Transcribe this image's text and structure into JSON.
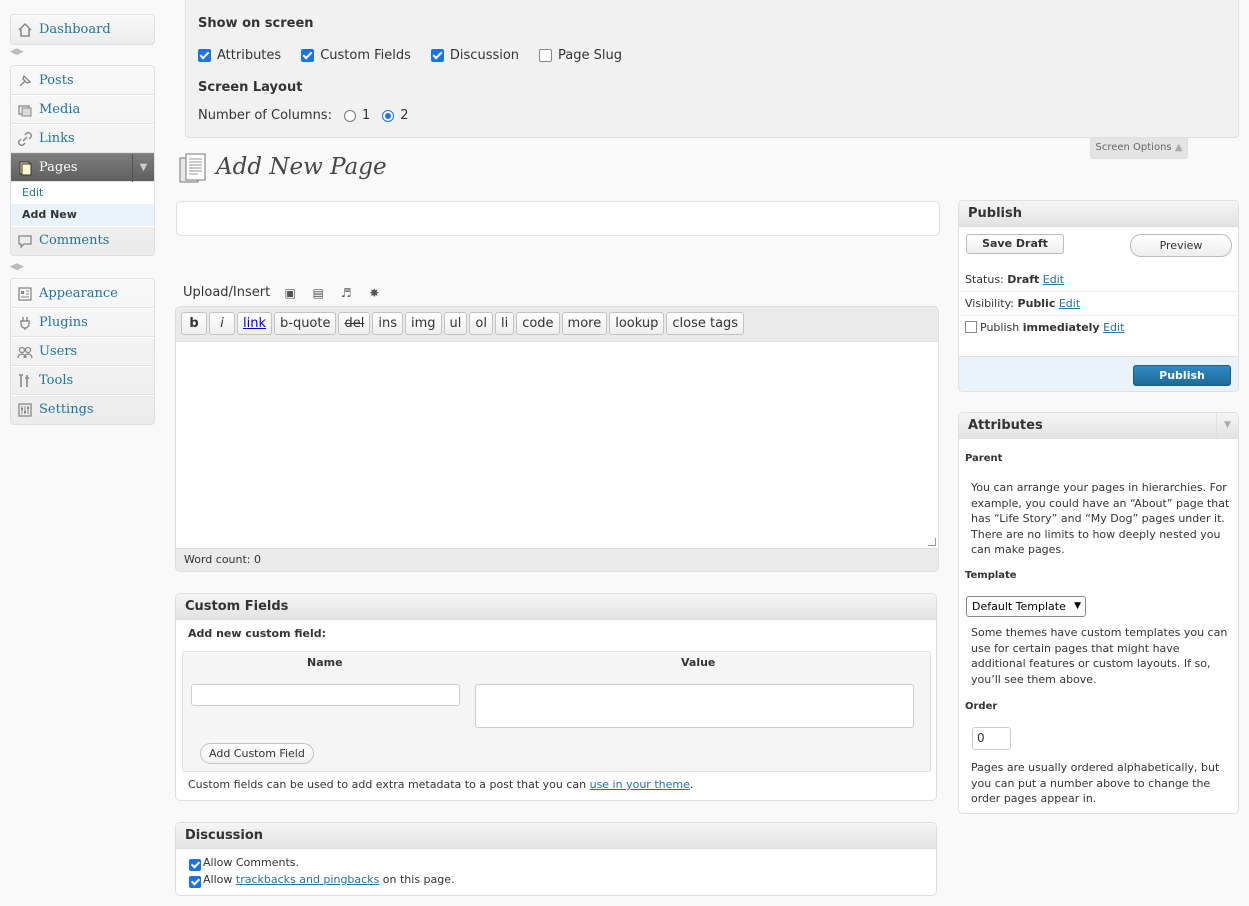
{
  "sidebar": {
    "dashboard": "Dashboard",
    "posts": "Posts",
    "media": "Media",
    "links": "Links",
    "pages": "Pages",
    "pages_sub": [
      "Edit",
      "Add New"
    ],
    "comments": "Comments",
    "appearance": "Appearance",
    "plugins": "Plugins",
    "users": "Users",
    "tools": "Tools",
    "settings": "Settings"
  },
  "screen_options": {
    "show_title": "Show on screen",
    "checkboxes": [
      {
        "label": "Attributes",
        "checked": true
      },
      {
        "label": "Custom Fields",
        "checked": true
      },
      {
        "label": "Discussion",
        "checked": true
      },
      {
        "label": "Page Slug",
        "checked": false
      }
    ],
    "layout_title": "Screen Layout",
    "columns_label": "Number of Columns:",
    "column_options": [
      "1",
      "2"
    ],
    "selected_column": "2",
    "tab_label": "Screen Options"
  },
  "page": {
    "title": "Add New Page",
    "title_value": ""
  },
  "editor": {
    "upload_label": "Upload/Insert",
    "buttons": [
      "b",
      "i",
      "link",
      "b-quote",
      "del",
      "ins",
      "img",
      "ul",
      "ol",
      "li",
      "code",
      "more",
      "lookup",
      "close tags"
    ],
    "content": "",
    "word_count": "Word count: 0"
  },
  "custom_fields": {
    "title": "Custom Fields",
    "add_new_label": "Add new custom field:",
    "col_name": "Name",
    "col_value": "Value",
    "add_button": "Add Custom Field",
    "help_prefix": "Custom fields can be used to add extra metadata to a post that you can ",
    "help_link": "use in your theme",
    "help_suffix": "."
  },
  "discussion": {
    "title": "Discussion",
    "allow_comments": "Allow Comments.",
    "allow_prefix": "Allow ",
    "allow_link": "trackbacks and pingbacks",
    "allow_suffix": " on this page."
  },
  "publish": {
    "title": "Publish",
    "save_draft": "Save Draft",
    "preview": "Preview",
    "status_label": "Status:",
    "status_value": "Draft",
    "visibility_label": "Visibility:",
    "visibility_value": "Public",
    "publish_label": "Publish",
    "publish_value": "immediately",
    "edit": "Edit",
    "publish_button": "Publish"
  },
  "attributes": {
    "title": "Attributes",
    "parent_heading": "Parent",
    "parent_help": "You can arrange your pages in hierarchies. For example, you could have an “About” page that has “Life Story” and “My Dog” pages under it. There are no limits to how deeply nested you can make pages.",
    "template_heading": "Template",
    "template_value": "Default Template",
    "template_help": "Some themes have custom templates you can use for certain pages that might have additional features or custom layouts. If so, you’ll see them above.",
    "order_heading": "Order",
    "order_value": "0",
    "order_help": "Pages are usually ordered alphabetically, but you can put a number above to change the order pages appear in."
  },
  "colors": {
    "link": "#21759b",
    "publish_button": "#21759b",
    "checkbox": "#1a73e8"
  }
}
